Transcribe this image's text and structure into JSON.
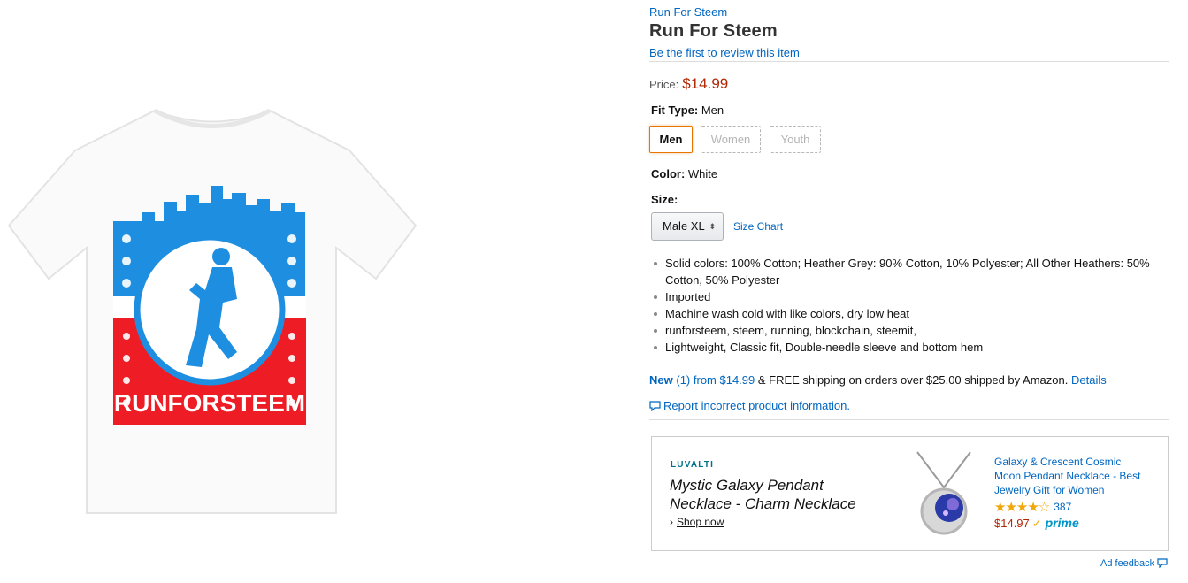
{
  "product": {
    "brand": "Run For Steem",
    "title": "Run For Steem",
    "review_link": "Be the first to review this item",
    "price_label": "Price:",
    "price": "$14.99",
    "image_text": "RUNFORSTEEM"
  },
  "fit_type": {
    "label": "Fit Type:",
    "value": "Men",
    "options": [
      "Men",
      "Women",
      "Youth"
    ]
  },
  "color": {
    "label": "Color:",
    "value": "White"
  },
  "size": {
    "label": "Size:",
    "selected": "Male XL",
    "size_chart": "Size Chart"
  },
  "bullets": [
    "Solid colors: 100% Cotton; Heather Grey: 90% Cotton, 10% Polyester; All Other Heathers: 50% Cotton, 50% Polyester",
    "Imported",
    "Machine wash cold with like colors, dry low heat",
    "runforsteem, steem, running, blockchain, steemit,",
    "Lightweight, Classic fit, Double-needle sleeve and bottom hem"
  ],
  "offers": {
    "new_label": "New",
    "count": "(1)",
    "from": "from $14.99",
    "shipping": " & FREE shipping on orders over $25.00 shipped by Amazon.",
    "details": "Details"
  },
  "report": "Report incorrect product information.",
  "ad": {
    "brand": "LUVALTI",
    "headline": "Mystic Galaxy Pendant Necklace - Charm Necklace",
    "shop_now": "Shop now",
    "product_title": "Galaxy & Crescent Cosmic Moon Pendant Necklace - Best Jewelry Gift for Women",
    "rating_stars": "★★★★☆",
    "rating_count": "387",
    "price": "$14.97",
    "prime": "prime",
    "feedback": "Ad feedback"
  },
  "colors": {
    "link": "#0066c0",
    "price": "#B12704",
    "shirt_blue": "#1e8fe0",
    "shirt_red": "#ee1c25"
  }
}
